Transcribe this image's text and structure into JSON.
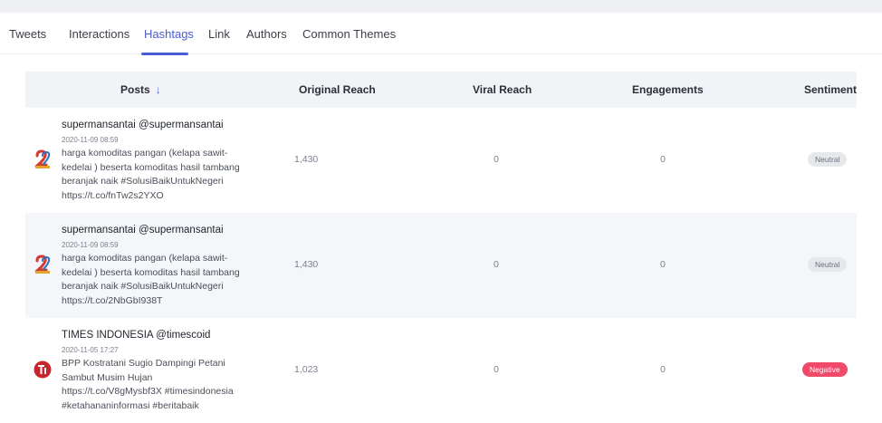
{
  "tabs": [
    {
      "label": "Tweets"
    },
    {
      "label": "Interactions"
    },
    {
      "label": "Hashtags",
      "active": true
    },
    {
      "label": "Link"
    },
    {
      "label": "Authors"
    },
    {
      "label": "Common Themes"
    }
  ],
  "table": {
    "headers": {
      "posts": "Posts",
      "original_reach": "Original Reach",
      "viral_reach": "Viral Reach",
      "engagements": "Engagements",
      "sentiment": "Sentiment"
    },
    "sort_icon": "↓",
    "rows": [
      {
        "author": "supermansantai @supermansantai",
        "time": "2020-11-09 08:59",
        "text": "harga komoditas pangan (kelapa sawit-kedelai ) beserta komoditas hasil tambang beranjak naik #SolusiBaikUntukNegeri https://t.co/fnTw2s2YXO",
        "original_reach": "1,430",
        "viral_reach": "0",
        "engagements": "0",
        "sentiment": "Neutral",
        "avatar_icon": "2-logo-icon"
      },
      {
        "author": "supermansantai @supermansantai",
        "time": "2020-11-09 08:59",
        "text": "harga komoditas pangan (kelapa sawit-kedelai ) beserta komoditas hasil tambang beranjak naik #SolusiBaikUntukNegeri https://t.co/2NbGbI938T",
        "original_reach": "1,430",
        "viral_reach": "0",
        "engagements": "0",
        "sentiment": "Neutral",
        "avatar_icon": "2-logo-icon"
      },
      {
        "author": "TIMES INDONESIA @timescoid",
        "time": "2020-11-05 17:27",
        "text": "BPP Kostratani Sugio Dampingi Petani Sambut Musim Hujan https://t.co/V8gMysbf3X #timesindonesia #ketahananinformasi #beritabaik",
        "original_reach": "1,023",
        "viral_reach": "0",
        "engagements": "0",
        "sentiment": "Negative",
        "avatar_icon": "ti-logo-icon"
      }
    ]
  },
  "colors": {
    "accent": "#4a5bd4",
    "negative": "#ef4a6a",
    "neutral_badge": "#e7e8ec"
  }
}
